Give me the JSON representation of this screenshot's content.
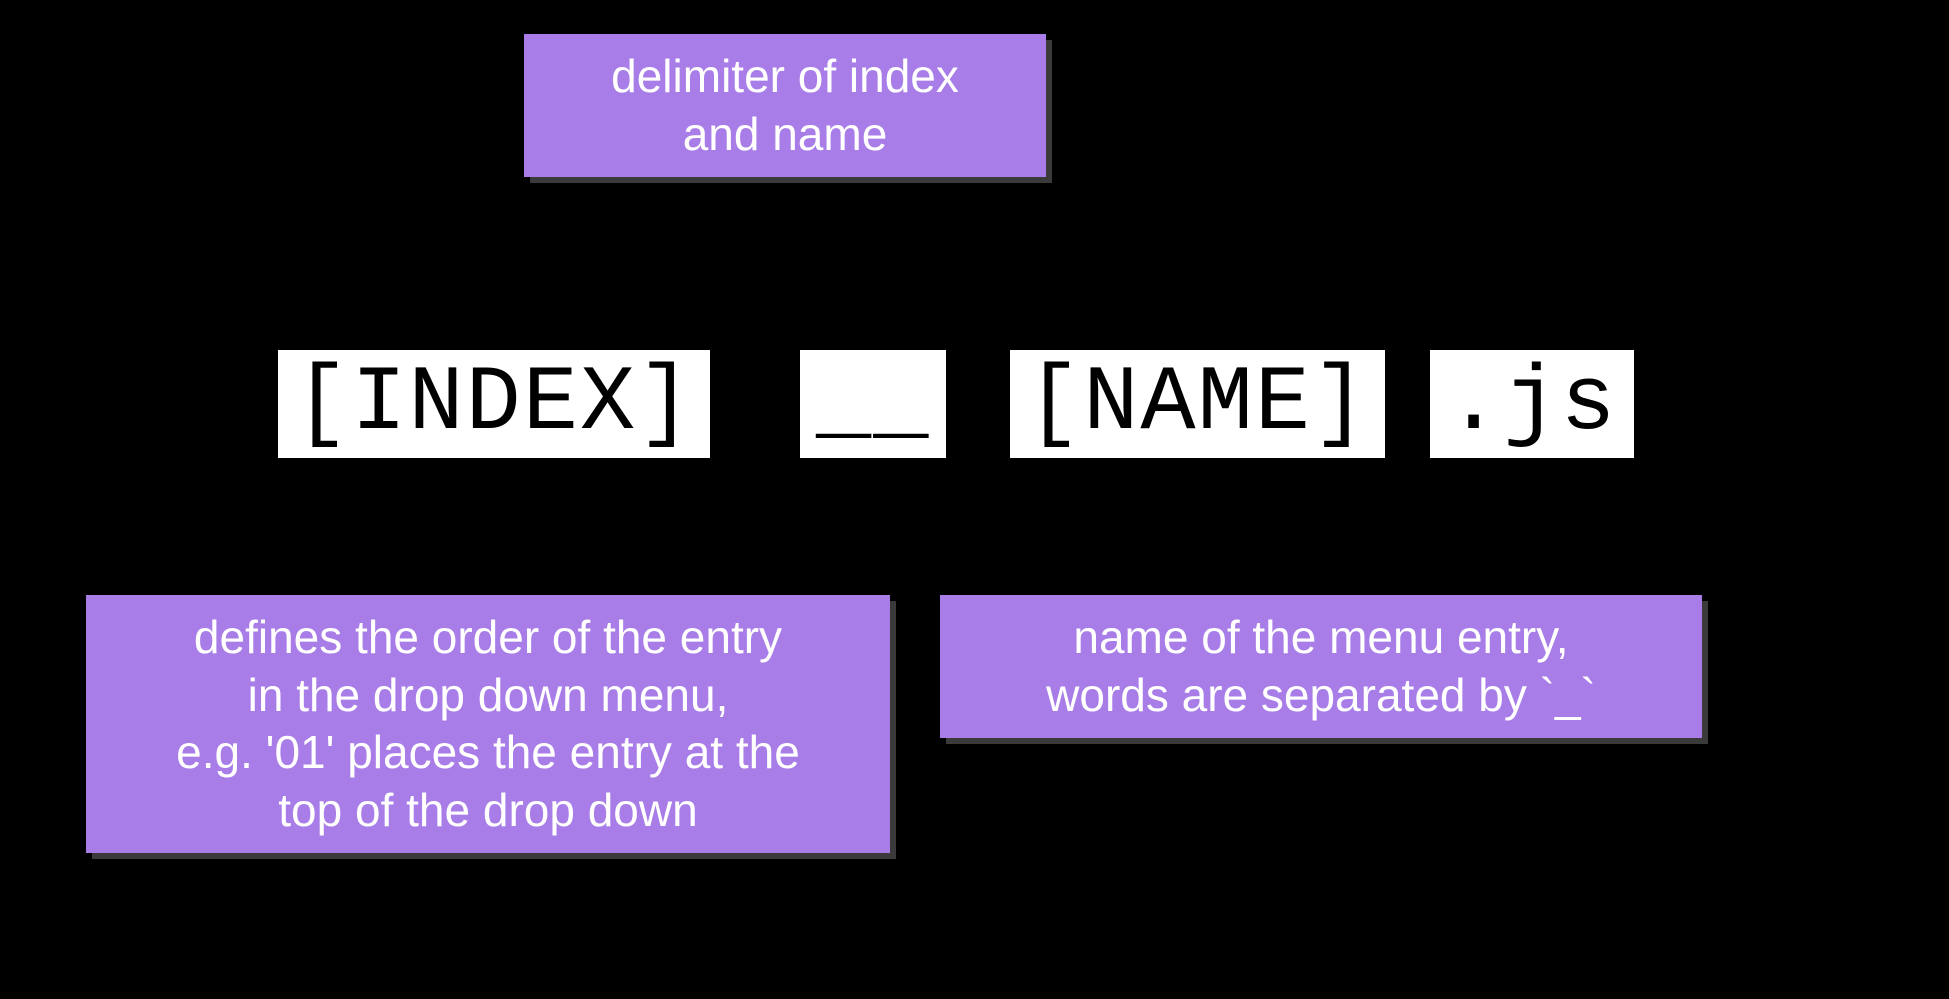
{
  "tokens": {
    "index": "[INDEX]",
    "delimiter": "__",
    "name": "[NAME]",
    "ext": ".js"
  },
  "labels": {
    "delimiter": {
      "line1": "delimiter of index",
      "line2": "and name"
    },
    "index": {
      "line1": "defines the order of the entry",
      "line2": "in the drop down menu,",
      "line3": "e.g. '01' places the entry at the",
      "line4": "top of the drop down"
    },
    "name": {
      "line1": "name of the menu entry,",
      "line2": "words are separated by `_`"
    }
  }
}
